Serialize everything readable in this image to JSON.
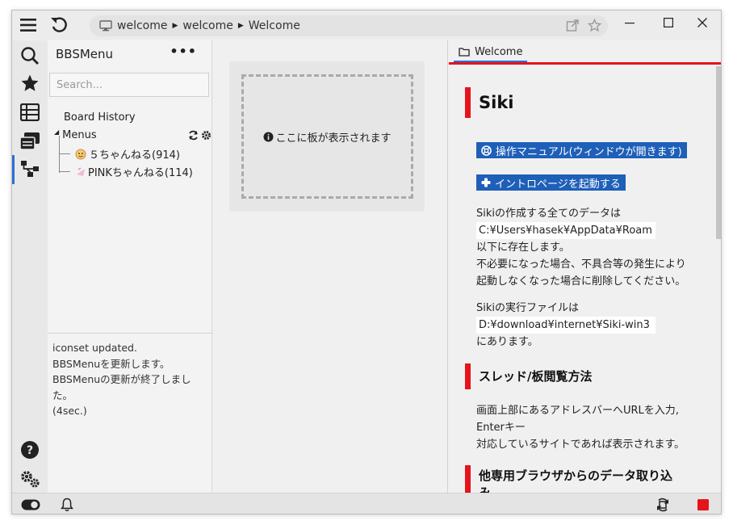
{
  "address": {
    "crumbs": [
      "welcome",
      "welcome",
      "Welcome"
    ]
  },
  "menu": {
    "title": "BBSMenu",
    "more": "•••",
    "search_placeholder": "Search...",
    "board_history": "Board History",
    "menus_label": "Menus",
    "items": [
      {
        "label": "５ちゃんねる(914)"
      },
      {
        "label": "PINKちゃんねる(114)"
      }
    ],
    "log": [
      "iconset updated.",
      "BBSMenuを更新します。",
      "BBSMenuの更新が終了しました。",
      "(4sec.)"
    ]
  },
  "board": {
    "placeholder": "ここに板が表示されます"
  },
  "welcome": {
    "tab_label": "Welcome",
    "title": "Siki",
    "manual_button": "操作マニュアル(ウィンドウが開きます)",
    "intro_button": "イントロページを起動する",
    "data_para": {
      "line1": "Sikiの作成する全てのデータは",
      "path": "C:¥Users¥hasek¥AppData¥Roam",
      "line2": "以下に存在します。",
      "line3": "不必要になった場合、不具合等の発生により",
      "line4": "起動しなくなった場合に削除してください。"
    },
    "exe_para": {
      "line1": "Sikiの実行ファイルは",
      "path": "D:¥download¥internet¥Siki-win3",
      "line2": "にあります。"
    },
    "section2_title": "スレッド/板閲覧方法",
    "section2_text": [
      "画面上部にあるアドレスバーへURLを入力,",
      "Enterキー",
      "対応しているサイトであれば表示されます。"
    ],
    "section3_title_line1": "他専用ブラウザからのデータ取り込",
    "section3_title_line2": "み"
  },
  "colors": {
    "accent_red": "#e5141a",
    "button_blue": "#1e5fb8",
    "active_indicator": "#2b6fd6",
    "stop_red": "#e5141a"
  }
}
